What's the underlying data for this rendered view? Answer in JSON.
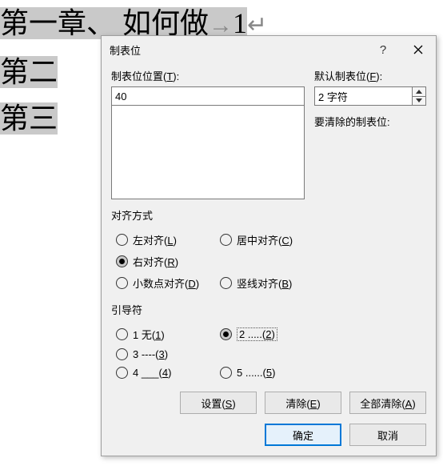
{
  "background": {
    "line1_a": "第一章、 如何做",
    "line1_b": "1",
    "line2": "第二",
    "line3": "第三"
  },
  "dialog": {
    "title": "制表位",
    "tabpos_label_pre": "制表位位置(",
    "tabpos_label_key": "T",
    "tabpos_label_post": "):",
    "tabpos_value": "40",
    "default_label_pre": "默认制表位(",
    "default_label_key": "F",
    "default_label_post": "):",
    "default_value": "2 字符",
    "clear_label": "要清除的制表位:",
    "align_section": "对齐方式",
    "align": {
      "left_pre": "左对齐(",
      "left_key": "L",
      "left_post": ")",
      "center_pre": "居中对齐(",
      "center_key": "C",
      "center_post": ")",
      "right_pre": "右对齐(",
      "right_key": "R",
      "right_post": ")",
      "decimal_pre": "小数点对齐(",
      "decimal_key": "D",
      "decimal_post": ")",
      "bar_pre": "竖线对齐(",
      "bar_key": "B",
      "bar_post": ")",
      "selected": "right"
    },
    "leader_section": "引导符",
    "leader": {
      "l1_pre": "1 无(",
      "l1_key": "1",
      "l1_post": ")",
      "l2_pre": "2 .....(",
      "l2_key": "2",
      "l2_post": ")",
      "l3_pre": "3 ----(",
      "l3_key": "3",
      "l3_post": ")",
      "l4_pre": "4 ___(",
      "l4_key": "4",
      "l4_post": ")",
      "l5_pre": "5 ......(",
      "l5_key": "5",
      "l5_post": ")",
      "selected": "2"
    },
    "buttons": {
      "set_pre": "设置(",
      "set_key": "S",
      "set_post": ")",
      "clear_pre": "清除(",
      "clear_key": "E",
      "clear_post": ")",
      "clear_all_pre": "全部清除(",
      "clear_all_key": "A",
      "clear_all_post": ")",
      "ok": "确定",
      "cancel": "取消"
    }
  }
}
